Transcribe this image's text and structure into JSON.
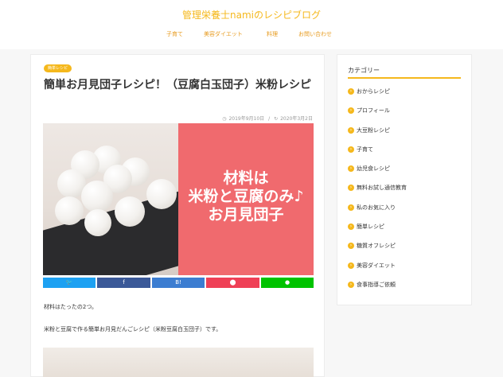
{
  "site": {
    "title": "管理栄養士namiのレシピブログ"
  },
  "nav": {
    "items": [
      {
        "label": "子育て"
      },
      {
        "label": "美容ダイエット"
      },
      {
        "label": "料理"
      },
      {
        "label": "お問い合わせ"
      }
    ]
  },
  "post": {
    "badge": "簡単レシピ",
    "title": "簡単お月見団子レシピ！（豆腐白玉団子）米粉レシピ",
    "published": "2019年9月10日",
    "separator": "/",
    "updated": "2020年3月2日",
    "hero_text": [
      "材料は",
      "米粉と豆腐のみ♪",
      "お月見団子"
    ],
    "paragraphs": [
      "材料はたったの2つ。",
      "米粉と豆腐で作る簡単お月見だんごレシピ（米粉豆腐白玉団子）です。"
    ]
  },
  "share": {
    "buttons": [
      {
        "label": "🐦",
        "color": "#1da1f2",
        "icon": "twitter-icon"
      },
      {
        "label": "f",
        "color": "#3b5998",
        "icon": "facebook-icon"
      },
      {
        "label": "B!",
        "color": "#3c7dd1",
        "icon": "hatena-bookmark-icon"
      },
      {
        "label": "⬤",
        "color": "#ef4056",
        "icon": "pocket-icon"
      },
      {
        "label": "●",
        "color": "#00c300",
        "icon": "line-icon"
      }
    ]
  },
  "sidebar": {
    "title": "カテゴリー",
    "items": [
      {
        "label": "おからレシピ"
      },
      {
        "label": "プロフィール"
      },
      {
        "label": "大豆粉レシピ"
      },
      {
        "label": "子育て"
      },
      {
        "label": "幼児食レシピ"
      },
      {
        "label": "無料お試し通信教育"
      },
      {
        "label": "私のお気に入り"
      },
      {
        "label": "簡単レシピ"
      },
      {
        "label": "糖質オフレシピ"
      },
      {
        "label": "美容ダイエット"
      },
      {
        "label": "食事指導ご依頼"
      }
    ],
    "bullet_glyph": "›"
  },
  "colors": {
    "accent": "#f5b81c",
    "hero_pink": "#f06a6e"
  }
}
